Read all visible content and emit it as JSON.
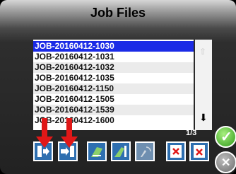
{
  "title": "Job Files",
  "files": [
    "JOB-20160412-1030",
    "JOB-20160412-1031",
    "JOB-20160412-1032",
    "JOB-20160412-1035",
    "JOB-20160412-1150",
    "JOB-20160412-1505",
    "JOB-20160412-1539",
    "JOB-20160412-1600"
  ],
  "selected_index": 0,
  "pagination": "1/3",
  "colors": {
    "selection": "#1b2be6",
    "button": "#2e6fb0",
    "arrow": "#e01818",
    "ok": "#3bb31f"
  },
  "toolbar": [
    {
      "name": "import-to-usb-button",
      "icon": "export-arrow-icon"
    },
    {
      "name": "export-button",
      "icon": "arrow-right-icon"
    },
    {
      "name": "measure-button-1",
      "icon": "tool-icon"
    },
    {
      "name": "measure-button-2",
      "icon": "tool-alt-icon"
    },
    {
      "name": "signal-button",
      "icon": "signal-icon"
    },
    {
      "name": "delete-selected-button",
      "icon": "trash-icon"
    },
    {
      "name": "delete-all-button",
      "icon": "delete-icon"
    }
  ]
}
